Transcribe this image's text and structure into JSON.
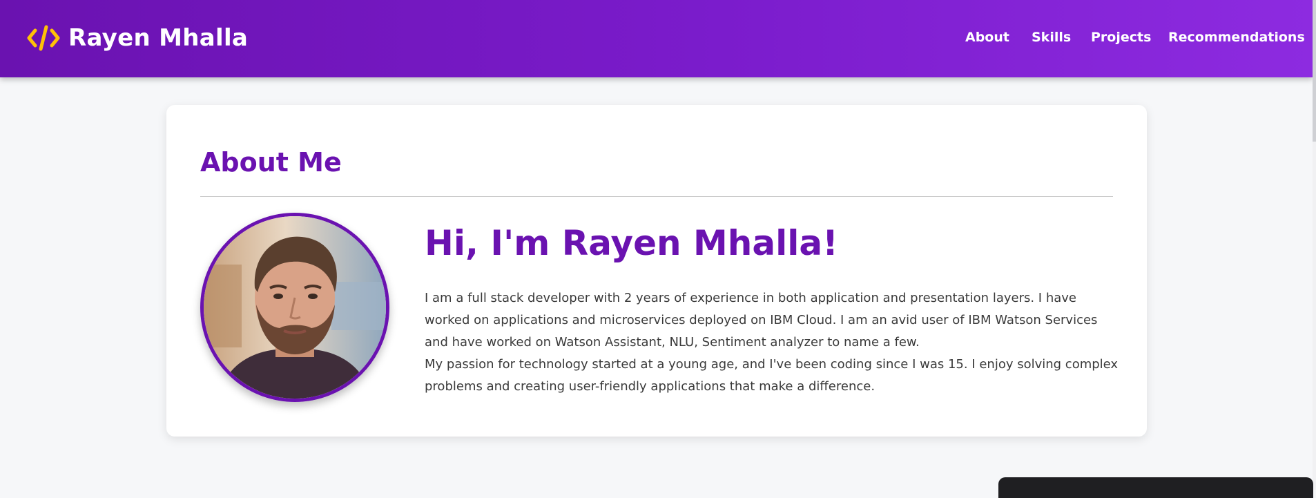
{
  "navbar": {
    "brand_icon": "code-icon",
    "brand_name": "Rayen Mhalla",
    "links": [
      {
        "label": "About"
      },
      {
        "label": "Skills"
      },
      {
        "label": "Projects"
      },
      {
        "label": "Recommendations"
      }
    ]
  },
  "about": {
    "title": "About Me",
    "greeting": "Hi, I'm Rayen Mhalla!",
    "paragraphs": [
      "I am a full stack developer with 2 years of experience in both application and presentation layers. I have worked on applications and microservices deployed on IBM Cloud. I am an avid user of IBM Watson Services and have worked on Watson Assistant, NLU, Sentiment analyzer to name a few.",
      "My passion for technology started at a young age, and I've been coding since I was 15. I enjoy solving complex problems and creating user-friendly applications that make a difference."
    ]
  },
  "colors": {
    "accent": "#6a12b0",
    "nav_gradient_start": "#6a12b0",
    "nav_gradient_end": "#8d2be0",
    "logo_icon": "#ffc107",
    "page_background": "#f6f7f9",
    "card_background": "#ffffff"
  }
}
